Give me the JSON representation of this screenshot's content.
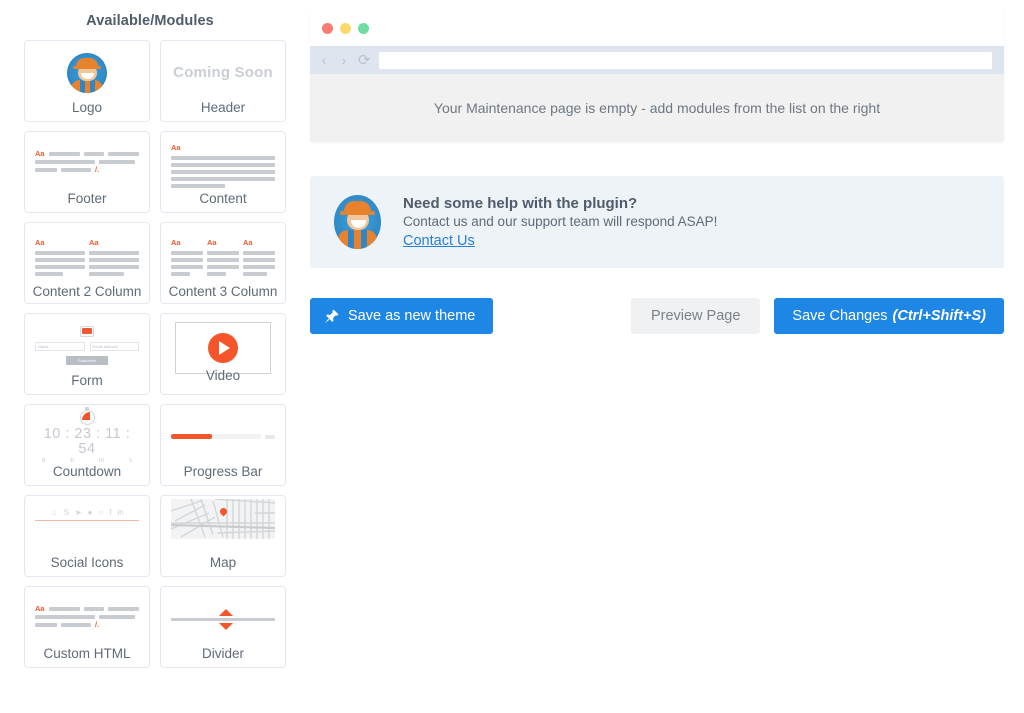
{
  "modules_panel": {
    "title": "Available/Modules",
    "modules": [
      {
        "label": "Logo",
        "thumb": "logo-avatar-icon",
        "badge": ""
      },
      {
        "label": "Header",
        "thumb": "coming-soon-text",
        "badge": "Coming Soon"
      },
      {
        "label": "Footer",
        "thumb": "footer-lines-icon",
        "badge": ""
      },
      {
        "label": "Content",
        "thumb": "content-lines-icon",
        "badge": ""
      },
      {
        "label": "Content 2 Column",
        "thumb": "content-2col-icon",
        "badge": ""
      },
      {
        "label": "Content 3 Column",
        "thumb": "content-3col-icon",
        "badge": ""
      },
      {
        "label": "Form",
        "thumb": "form-icon",
        "badge": ""
      },
      {
        "label": "Video",
        "thumb": "video-play-icon",
        "badge": ""
      },
      {
        "label": "Countdown",
        "thumb": "countdown-icon",
        "badge": ""
      },
      {
        "label": "Progress Bar",
        "thumb": "progress-bar-icon",
        "badge": ""
      },
      {
        "label": "Social Icons",
        "thumb": "social-icons-icon",
        "badge": ""
      },
      {
        "label": "Map",
        "thumb": "map-icon",
        "badge": ""
      },
      {
        "label": "Custom HTML",
        "thumb": "custom-html-icon",
        "badge": ""
      },
      {
        "label": "Divider",
        "thumb": "divider-icon",
        "badge": ""
      }
    ],
    "form_thumb": {
      "name_placeholder": "Name",
      "email_placeholder": "Email address",
      "submit_label": "Subscribe"
    },
    "countdown_thumb": {
      "digits": "10 : 23 : 11 : 54",
      "units": [
        "d",
        "h",
        "m",
        "s"
      ]
    },
    "aa_marker": "Aa"
  },
  "browser_preview": {
    "traffic_lights": [
      "close-red",
      "minimize-yellow",
      "maximize-green"
    ],
    "back_icon": "‹",
    "forward_icon": "›",
    "reload_icon": "⟳",
    "url_value": "",
    "url_placeholder": "",
    "empty_message": "Your Maintenance page is empty - add modules from the list on the right"
  },
  "help_banner": {
    "title": "Need some help with the plugin?",
    "subtitle": "Contact us and our support team will respond ASAP!",
    "link_label": "Contact Us",
    "avatar": "mascot-avatar"
  },
  "actions": {
    "save_theme_label": "Save as new theme",
    "save_theme_icon": "pushpin-icon",
    "preview_label": "Preview Page",
    "save_changes_label": "Save Changes",
    "save_changes_shortcut": "(Ctrl+Shift+S)"
  },
  "colors": {
    "accent_blue": "#1e87e5",
    "accent_orange": "#f4552b",
    "panel_bg": "#eef3f7",
    "text": "#5a6570",
    "muted": "#c9ced6"
  }
}
